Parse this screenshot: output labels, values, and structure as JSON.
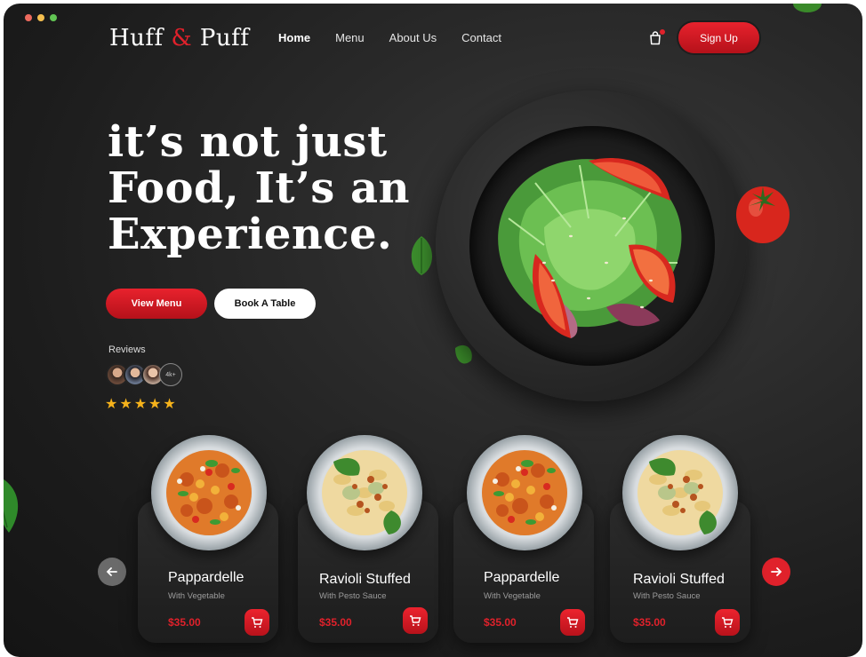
{
  "window": {
    "dots": [
      "#ed6a5e",
      "#f5bf4f",
      "#62c554"
    ]
  },
  "brand": {
    "part1": "Huff",
    "amp": "&",
    "part2": "Puff",
    "accent": "#e0212b"
  },
  "nav": {
    "items": [
      "Home",
      "Menu",
      "About Us",
      "Contact"
    ],
    "active": "Home"
  },
  "header": {
    "signup_label": "Sign Up"
  },
  "hero": {
    "title_line1": "it’s not just",
    "title_line2": "Food, It’s an",
    "title_line3": "Experience.",
    "view_menu_label": "View Menu",
    "book_table_label": "Book A Table"
  },
  "reviews": {
    "label": "Reviews",
    "extra_count": "4k+",
    "rating": 5
  },
  "cards": [
    {
      "title": "Pappardelle",
      "subtitle": "With Vegetable",
      "price": "$35.00",
      "dish": "pasta-veg"
    },
    {
      "title": "Ravioli Stuffed",
      "subtitle": "With Pesto Sauce",
      "price": "$35.00",
      "dish": "farfalle-pesto"
    },
    {
      "title": "Pappardelle",
      "subtitle": "With Vegetable",
      "price": "$35.00",
      "dish": "pasta-veg"
    },
    {
      "title": "Ravioli Stuffed",
      "subtitle": "With Pesto Sauce",
      "price": "$35.00",
      "dish": "farfalle-pesto"
    }
  ],
  "carousel": {
    "prev_icon": "arrow-left-icon",
    "next_icon": "arrow-right-icon"
  }
}
